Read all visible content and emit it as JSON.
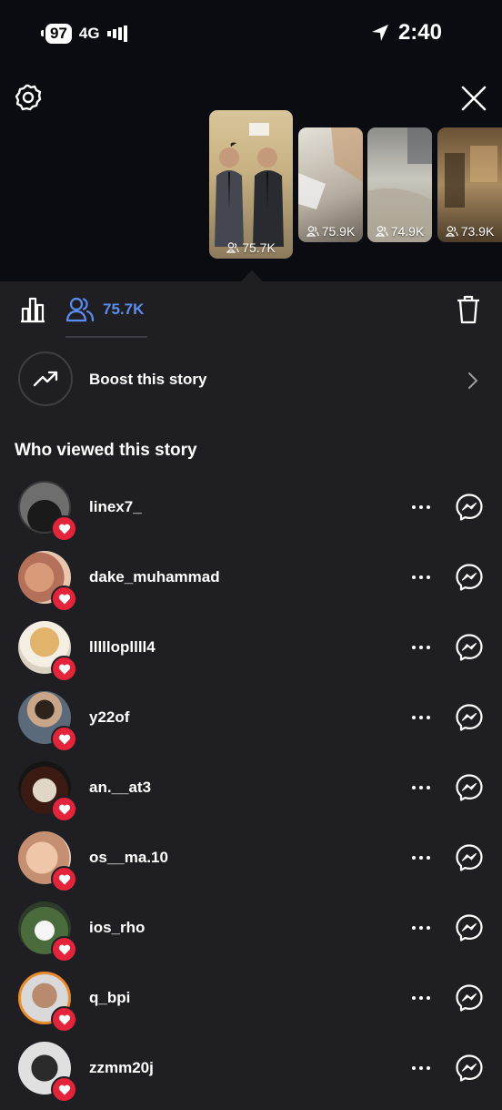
{
  "status_bar": {
    "battery": "97",
    "network": "4G",
    "time": "2:40"
  },
  "thumbnails": [
    {
      "views": "75.7K",
      "selected": true
    },
    {
      "views": "75.9K"
    },
    {
      "views": "74.9K"
    },
    {
      "views": "73.9K"
    }
  ],
  "tabs": {
    "viewers_count": "75.7K"
  },
  "boost": {
    "label": "Boost this story"
  },
  "viewers_title": "Who viewed this story",
  "viewers": [
    {
      "username": "linex7_",
      "liked": true
    },
    {
      "username": "dake_muhammad",
      "liked": true
    },
    {
      "username": "lllllopllll4",
      "liked": true
    },
    {
      "username": "y22of",
      "liked": true
    },
    {
      "username": "an.__at3",
      "liked": true
    },
    {
      "username": "os__ma.10",
      "liked": true
    },
    {
      "username": "ios_rho",
      "liked": true
    },
    {
      "username": "q_bpi",
      "liked": true
    },
    {
      "username": "zzmm20j",
      "liked": true
    }
  ],
  "colors": {
    "accent": "#5b8cf0",
    "like": "#e3243b",
    "background": "#1f1f23",
    "header": "#0b0c11"
  }
}
